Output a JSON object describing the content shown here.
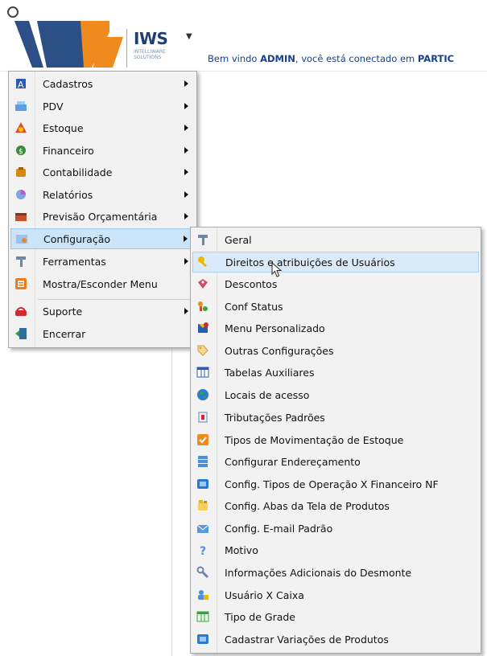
{
  "header": {
    "logo_text": "IWS",
    "logo_sub": "INTELLIWARE SOLUTIONS",
    "welcome_prefix": "Bem vindo ",
    "welcome_user": "ADMIN",
    "welcome_mid": ", você está conectado em ",
    "welcome_company": "PARTIC"
  },
  "main_menu": {
    "items": [
      {
        "label": "Cadastros",
        "icon": "cadastros-icon"
      },
      {
        "label": "PDV",
        "icon": "pdv-icon"
      },
      {
        "label": "Estoque",
        "icon": "estoque-icon"
      },
      {
        "label": "Financeiro",
        "icon": "financeiro-icon"
      },
      {
        "label": "Contabilidade",
        "icon": "contabilidade-icon"
      },
      {
        "label": "Relatórios",
        "icon": "relatorios-icon"
      },
      {
        "label": "Previsão Orçamentária",
        "icon": "previsao-icon"
      },
      {
        "label": "Configuração",
        "icon": "configuracao-icon"
      },
      {
        "label": "Ferramentas",
        "icon": "ferramentas-icon"
      },
      {
        "label": "Mostra/Esconder Menu",
        "icon": "mostrar-menu-icon"
      },
      {
        "label": "Suporte",
        "icon": "suporte-icon"
      },
      {
        "label": "Encerrar",
        "icon": "encerrar-icon"
      }
    ]
  },
  "sub_menu": {
    "items": [
      {
        "label": "Geral"
      },
      {
        "label": "Direitos e atribuições de Usuários"
      },
      {
        "label": "Descontos"
      },
      {
        "label": "Conf Status"
      },
      {
        "label": "Menu Personalizado"
      },
      {
        "label": "Outras Configurações"
      },
      {
        "label": "Tabelas Auxiliares"
      },
      {
        "label": "Locais de acesso"
      },
      {
        "label": "Tributações Padrões"
      },
      {
        "label": "Tipos de Movimentação de Estoque"
      },
      {
        "label": "Configurar Endereçamento"
      },
      {
        "label": "Config. Tipos de Operação X Financeiro NF"
      },
      {
        "label": "Config. Abas da Tela de Produtos"
      },
      {
        "label": "Config. E-mail Padrão"
      },
      {
        "label": "Motivo"
      },
      {
        "label": "Informações Adicionais do Desmonte"
      },
      {
        "label": "Usuário X Caixa"
      },
      {
        "label": "Tipo de Grade"
      },
      {
        "label": "Cadastrar Variações de Produtos"
      }
    ]
  },
  "colors": {
    "highlight": "#cce4f7",
    "brand_blue": "#1f3f73",
    "brand_orange": "#f08a1c"
  }
}
